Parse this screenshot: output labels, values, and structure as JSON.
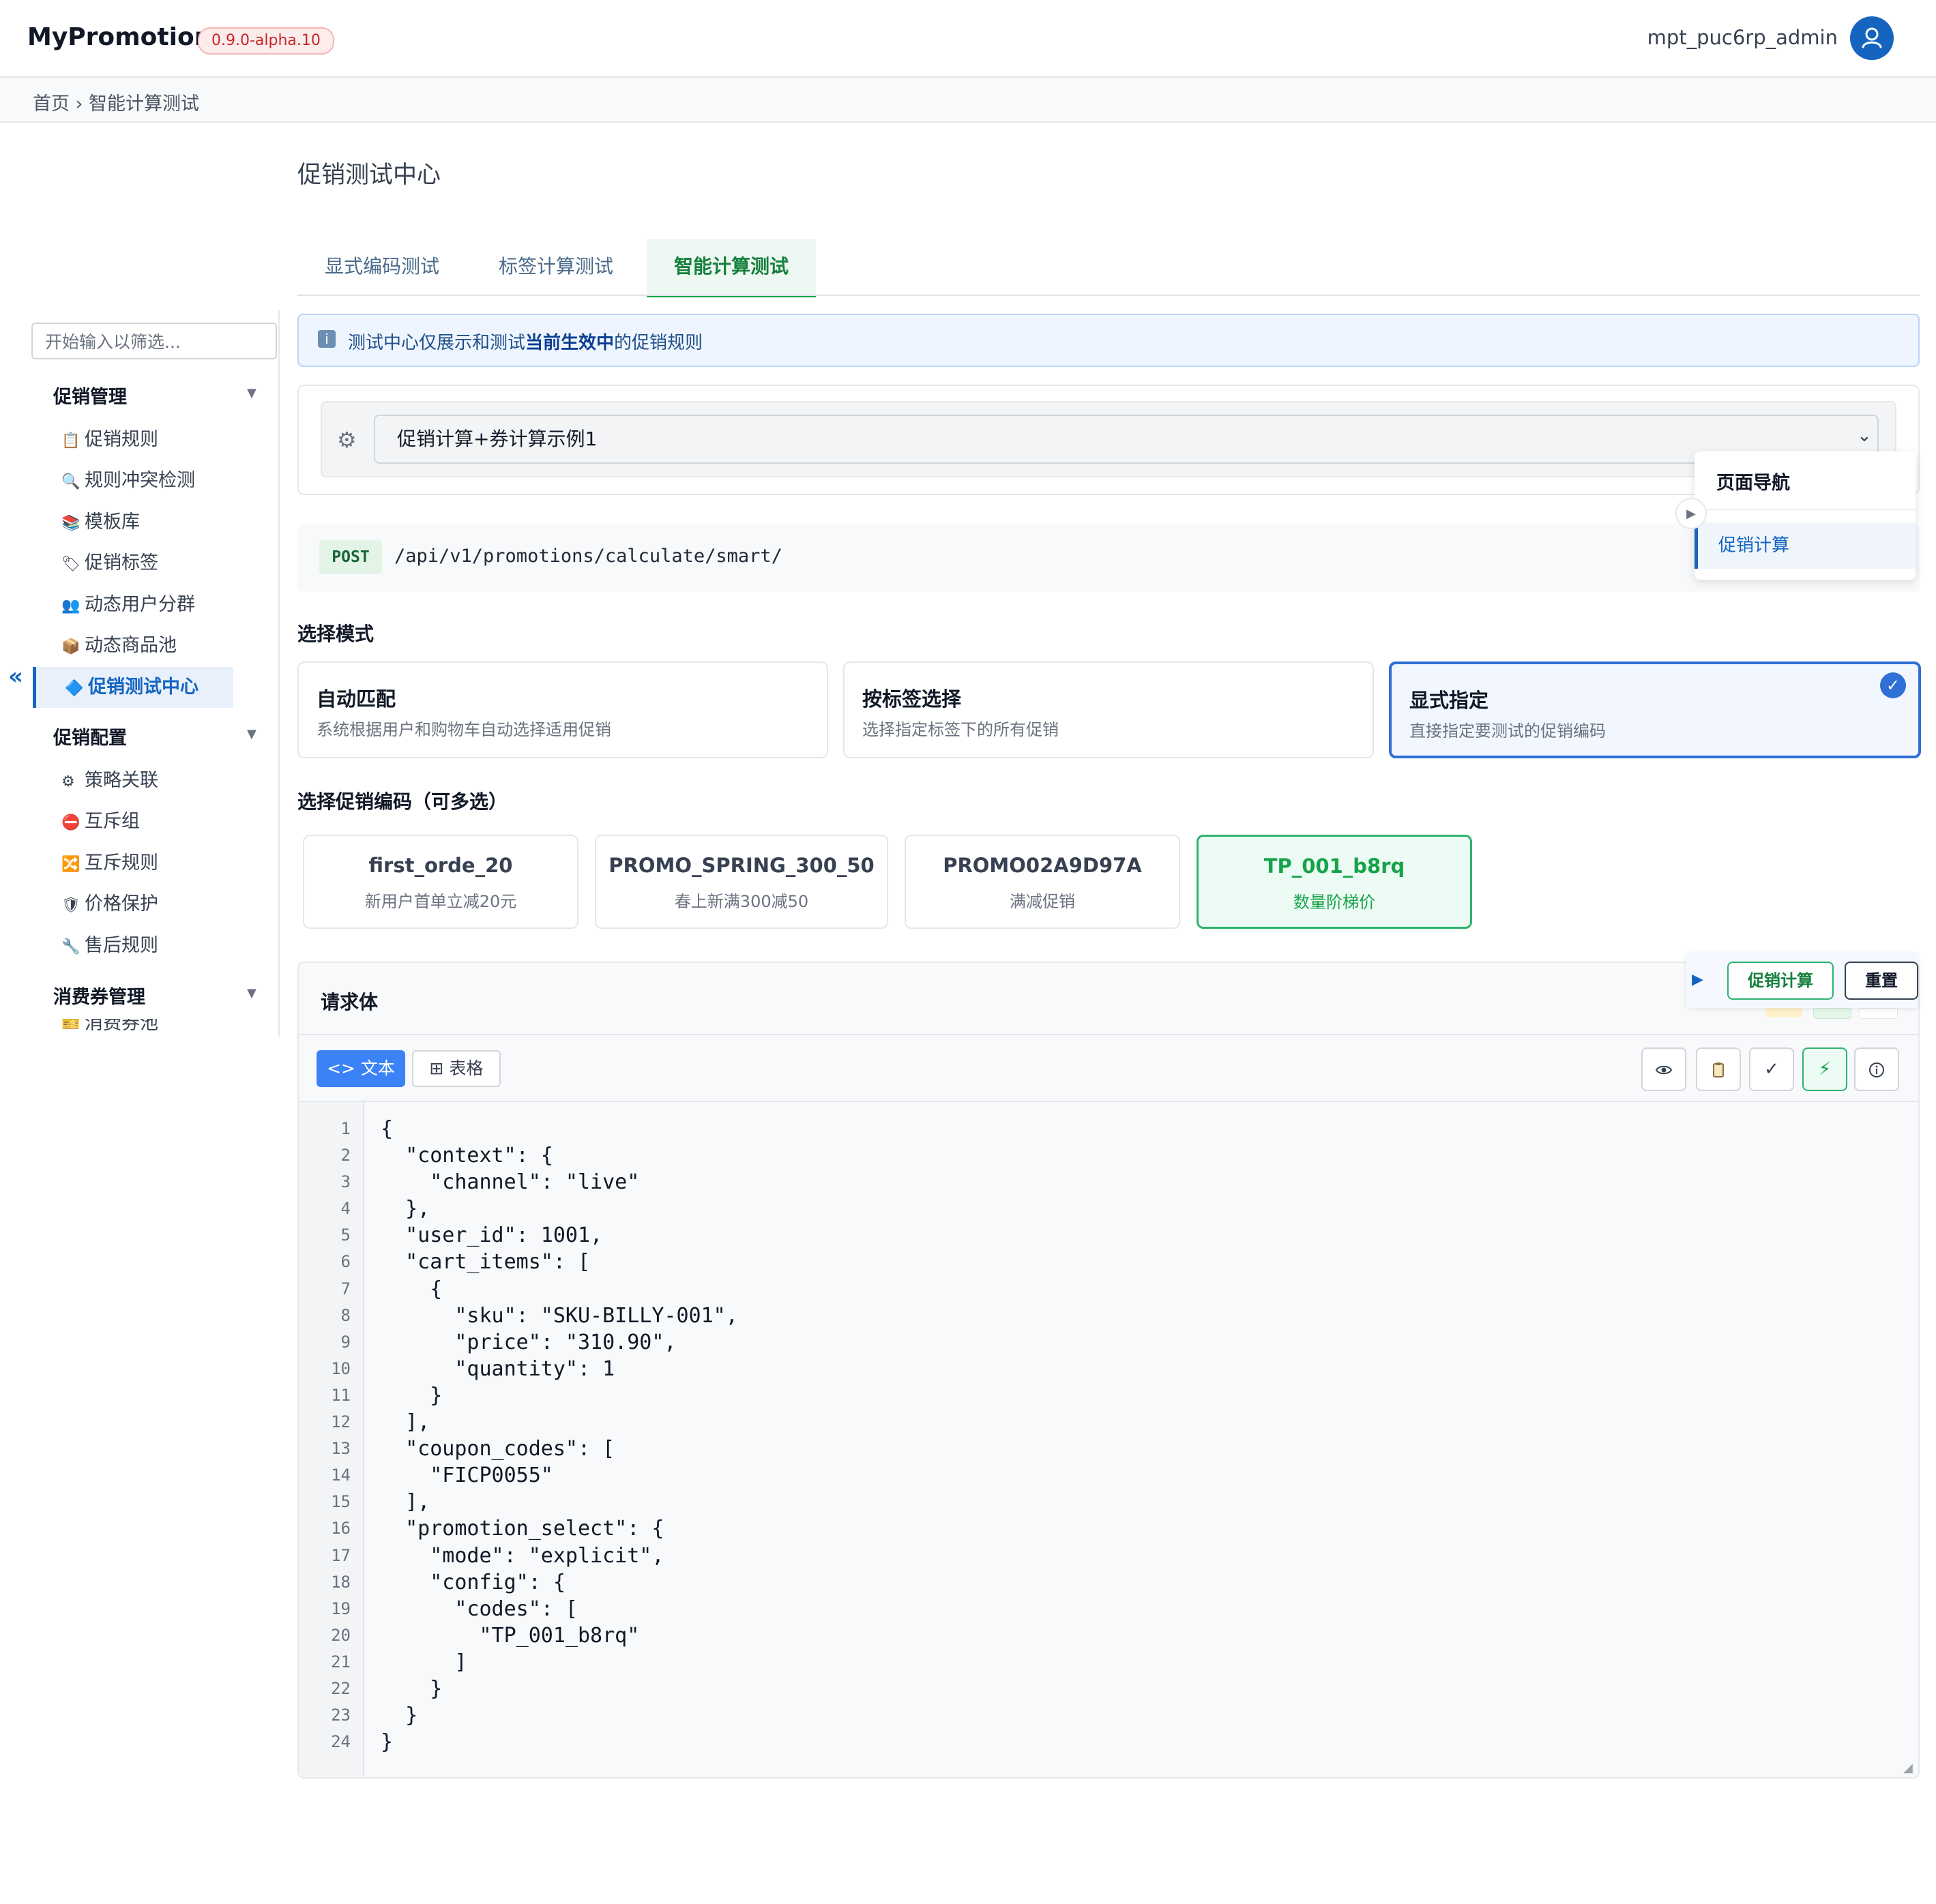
{
  "header": {
    "app_title": "MyPromotion",
    "version": "0.9.0-alpha.10",
    "username": "mpt_puc6rp_admin"
  },
  "breadcrumb": {
    "home": "首页",
    "sep": "›",
    "current": "智能计算测试"
  },
  "page_title": "促销测试中心",
  "tabs": [
    {
      "label": "显式编码测试"
    },
    {
      "label": "标签计算测试"
    },
    {
      "label": "智能计算测试",
      "active": true
    }
  ],
  "sidebar": {
    "filter_placeholder": "开始输入以筛选...",
    "sections": [
      {
        "title": "促销管理",
        "items": [
          {
            "icon": "📋",
            "label": "促销规则"
          },
          {
            "icon": "🔍",
            "label": "规则冲突检测"
          },
          {
            "icon": "📚",
            "label": "模板库"
          },
          {
            "icon": "🏷",
            "label": "促销标签"
          },
          {
            "icon": "👥",
            "label": "动态用户分群"
          },
          {
            "icon": "📦",
            "label": "动态商品池"
          },
          {
            "icon": "🔷",
            "label": "促销测试中心"
          }
        ]
      },
      {
        "title": "促销配置",
        "items": [
          {
            "icon": "⚙",
            "label": "策略关联"
          },
          {
            "icon": "⛔",
            "label": "互斥组"
          },
          {
            "icon": "🔀",
            "label": "互斥规则"
          },
          {
            "icon": "🛡",
            "label": "价格保护"
          },
          {
            "icon": "🔧",
            "label": "售后规则"
          }
        ]
      },
      {
        "title": "消费券管理",
        "items": [
          {
            "icon": "🎫",
            "label": "消费券池"
          }
        ]
      }
    ],
    "collapse_glyph": "«"
  },
  "info_banner": {
    "prefix": "测试中心仅展示和测试",
    "highlight": "当前生效中",
    "suffix": "的促销规则"
  },
  "scenario_select": {
    "value": "促销计算+券计算示例1"
  },
  "endpoint": {
    "method": "POST",
    "path": "/api/v1/promotions/calculate/smart/"
  },
  "page_nav": {
    "title": "页面导航",
    "item": "促销计算"
  },
  "mode": {
    "title": "选择模式",
    "options": [
      {
        "title": "自动匹配",
        "desc": "系统根据用户和购物车自动选择适用促销"
      },
      {
        "title": "按标签选择",
        "desc": "选择指定标签下的所有促销"
      },
      {
        "title": "显式指定",
        "desc": "直接指定要测试的促销编码",
        "selected": true
      }
    ]
  },
  "codes": {
    "title": "选择促销编码（可多选）",
    "items": [
      {
        "code": "first_orde_20",
        "name": "新用户首单立减20元"
      },
      {
        "code": "PROMO_SPRING_300_50",
        "name": "春上新满300减50"
      },
      {
        "code": "PROMO02A9D97A",
        "name": "满减促销"
      },
      {
        "code": "TP_001_b8rq",
        "name": "数量阶梯价",
        "selected": true
      }
    ]
  },
  "request_body": {
    "title": "请求体",
    "calc_button": "促销计算",
    "reset_button": "重置",
    "view_text": "<> 文本",
    "view_table": "⊞ 表格",
    "line_numbers": [
      "1",
      "2",
      "3",
      "4",
      "5",
      "6",
      "7",
      "8",
      "9",
      "10",
      "11",
      "12",
      "13",
      "14",
      "15",
      "16",
      "17",
      "18",
      "19",
      "20",
      "21",
      "22",
      "23",
      "24"
    ],
    "code": "{\n  \"context\": {\n    \"channel\": \"live\"\n  },\n  \"user_id\": 1001,\n  \"cart_items\": [\n    {\n      \"sku\": \"SKU-BILLY-001\",\n      \"price\": \"310.90\",\n      \"quantity\": 1\n    }\n  ],\n  \"coupon_codes\": [\n    \"FICP0055\"\n  ],\n  \"promotion_select\": {\n    \"mode\": \"explicit\",\n    \"config\": {\n      \"codes\": [\n        \"TP_001_b8rq\"\n      ]\n    }\n  }\n}"
  }
}
